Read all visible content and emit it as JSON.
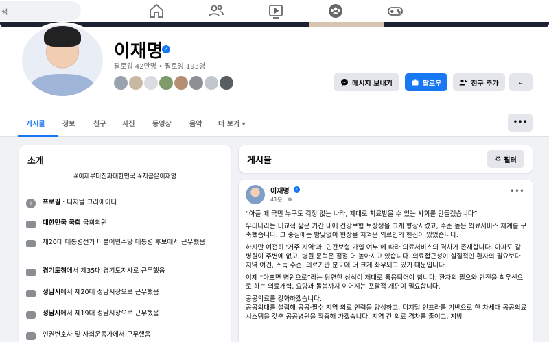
{
  "nav": {
    "search_placeholder": "색",
    "icons": [
      "home-icon",
      "friends-icon",
      "video-icon",
      "groups-icon",
      "gaming-icon"
    ]
  },
  "profile": {
    "name": "이재명",
    "stats": "팔로워 42만명 • 팔로잉 193명",
    "buttons": {
      "message": "메시지 보내기",
      "follow": "팔로우",
      "add_friend": "친구 추가"
    }
  },
  "tabs": [
    "게시물",
    "정보",
    "친구",
    "사진",
    "동영상",
    "음악",
    "더 보기 ▾"
  ],
  "intro": {
    "title": "소개",
    "hashtags": "#이제부터진짜대한민국 #지금은이재명",
    "items": [
      {
        "bold": "프로필",
        "text": " · 디지털 크리에이터"
      },
      {
        "bold": "대한민국 국회",
        "text": " 국회의원"
      },
      {
        "bold": "",
        "text": "제20대 대통령선거 더불어민주당 대통령 후보에서 근무했음"
      },
      {
        "bold": "경기도청",
        "text": "에서 제35대 경기도지사로 근무했음"
      },
      {
        "bold": "성남시",
        "text": "에서 제20대 성남시장으로 근무했음"
      },
      {
        "bold": "성남시",
        "text": "에서 제19대 성남시장으로 근무했음"
      },
      {
        "bold": "",
        "text": "인권변호사 및 사회운동가에서 근무했음"
      }
    ]
  },
  "posts": {
    "title": "게시물",
    "filter_label": "필터"
  },
  "post": {
    "author": "이재명",
    "time": "41분 · ",
    "paragraphs": [
      "“아플 때 국민 누구도 걱정 없는 나라, 제대로 치료받을 수 있는 사회를 만들겠습니다”",
      "우리나라는 비교적 짧은 기간 내에 건강보험 보장성을 크게 향상시켰고, 수준 높은 의료서비스 체계를 구축했습니다. 그 중심에는 밤낮없이 현장을 지켜온 의료인의 헌신이 있었습니다.",
      "하지만 여전히 ‘거주 지역’과 ‘민간보험 가입 여부’에 따라 의료서비스의 격차가 존재합니다. 아파도 갈 병원이 주변에 없고, 병원 문턱은 점점 더 높아지고 있습니다. 의료접근성이 실질적인 환자의 필요보다 지역 여건, 소득 수준, 의료기관 분포에 더 크게 좌우되고 있기 때문입니다.",
      "이제 “아프면 병원으로”라는 당연한 상식이 제대로 통용되어야 합니다. 환자의 필요와 안전을 최우선으로 하는 의료개혁, 요양과 돌봄까지 이어지는 포괄적 개편이 필요합니다.",
      "공공의료를 강화하겠습니다.\n공공의대를 설립해 공공·필수·지역 의료 인력을 양성하고, 디지털 인프라를 기반으로 한 차세대 공공의료시스템을 갖춘 공공병원을 확충해 가겠습니다. 지역 간 의료 격차를 줄이고, 지방"
    ]
  }
}
